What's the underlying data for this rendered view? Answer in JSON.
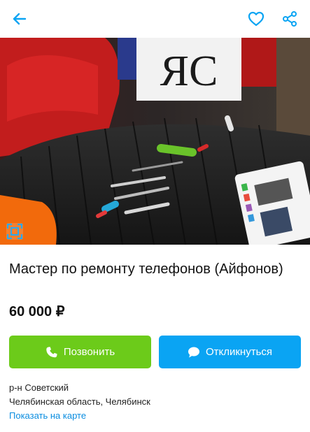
{
  "icons": {
    "back": "arrow-left-icon",
    "favorite": "heart-icon",
    "share": "share-icon",
    "gallery": "gallery-expand-icon",
    "phone": "phone-icon",
    "chat": "chat-bubble-icon"
  },
  "colors": {
    "accent": "#0aa4f3",
    "call_button": "#6ccb1a",
    "reply_button": "#0aa4f3",
    "link": "#0a8de0"
  },
  "listing": {
    "photo_brand": "ЯС",
    "title": "Мастер по ремонту телефонов (Айфонов)",
    "price": "60 000 ₽"
  },
  "actions": {
    "call_label": "Позвонить",
    "reply_label": "Откликнуться"
  },
  "location": {
    "district": "р-н Советский",
    "region_city": "Челябинская область, Челябинск",
    "map_link": "Показать на карте"
  }
}
